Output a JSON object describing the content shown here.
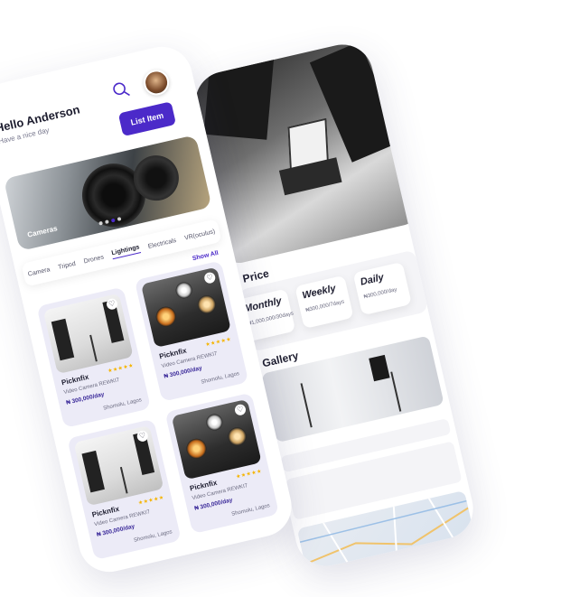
{
  "back_phone": {
    "price_section_title": "Price",
    "price_options": [
      {
        "label": "Monthly",
        "value": "₦1,000,000/30days"
      },
      {
        "label": "Weekly",
        "value": "₦300,000/7days"
      },
      {
        "label": "Daily",
        "value": "₦300,000/day"
      }
    ],
    "gallery_title": "Gallery"
  },
  "front_phone": {
    "greeting": "Hello Anderson",
    "subgreeting": "Have a nice day",
    "list_item_button": "List Item",
    "banner_label": "Cameras",
    "categories": [
      "Camera",
      "Tripod",
      "Drones",
      "Lightings",
      "Electricals",
      "VR(oculus)"
    ],
    "active_category": "Lightings",
    "show_all": "Show All",
    "products": [
      {
        "name": "Picknfix",
        "desc": "Video Camera REWKI7",
        "price": "₦ 300,000/day",
        "location": "Shomolu, Lagos",
        "rating": "★★★★★",
        "image": "studio"
      },
      {
        "name": "Picknfix",
        "desc": "Video Camera REWKI7",
        "price": "₦ 300,000/day",
        "location": "Shomolu, Lagos",
        "rating": "★★★★★",
        "image": "lamps"
      },
      {
        "name": "Picknfix",
        "desc": "Video Camera REWKI7",
        "price": "₦ 300,000/day",
        "location": "Shomolu, Lagos",
        "rating": "★★★★★",
        "image": "studio"
      },
      {
        "name": "Picknfix",
        "desc": "Video Camera REWKI7",
        "price": "₦ 300,000/day",
        "location": "Shomolu, Lagos",
        "rating": "★★★★★",
        "image": "lamps"
      }
    ]
  },
  "colors": {
    "accent": "#4b2ac9",
    "star": "#f5b400"
  },
  "icons": {
    "search": "search-icon",
    "heart": "heart-icon"
  }
}
